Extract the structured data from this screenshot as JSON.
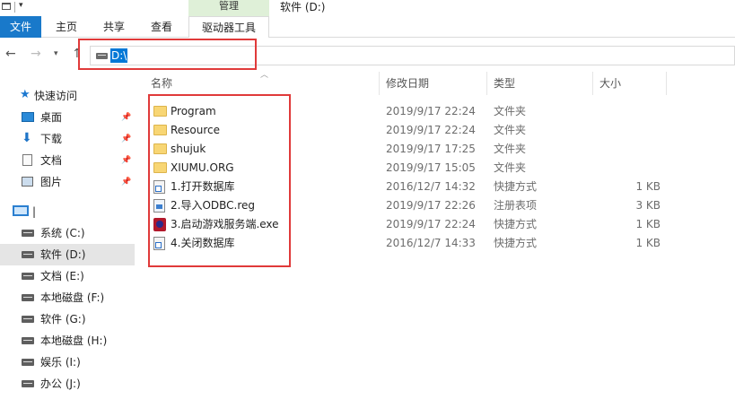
{
  "window": {
    "context_tab_header": "管理",
    "title": "软件 (D:)"
  },
  "ribbon": {
    "tabs": [
      "文件",
      "主页",
      "共享",
      "查看",
      "驱动器工具"
    ]
  },
  "address_bar": {
    "path": "D:\\"
  },
  "nav_pane": {
    "quick_access": "快速访问",
    "pinned": [
      "桌面",
      "下载",
      "文档",
      "图片"
    ],
    "this_pc": "|",
    "drives": [
      "系统 (C:)",
      "软件 (D:)",
      "文档 (E:)",
      "本地磁盘 (F:)",
      "软件 (G:)",
      "本地磁盘 (H:)",
      "娱乐 (I:)",
      "办公 (J:)"
    ]
  },
  "file_list": {
    "columns": [
      "名称",
      "修改日期",
      "类型",
      "大小"
    ],
    "rows": [
      {
        "name": "Program",
        "date": "2019/9/17 22:24",
        "type": "文件夹",
        "size": "",
        "icon": "folder-icon"
      },
      {
        "name": "Resource",
        "date": "2019/9/17 22:24",
        "type": "文件夹",
        "size": "",
        "icon": "folder-icon"
      },
      {
        "name": "shujuk",
        "date": "2019/9/17 17:25",
        "type": "文件夹",
        "size": "",
        "icon": "folder-icon"
      },
      {
        "name": "XIUMU.ORG",
        "date": "2019/9/17 15:05",
        "type": "文件夹",
        "size": "",
        "icon": "folder-icon"
      },
      {
        "name": "1.打开数据库",
        "date": "2016/12/7 14:32",
        "type": "快捷方式",
        "size": "1 KB",
        "icon": "shortcut-icon"
      },
      {
        "name": "2.导入ODBC.reg",
        "date": "2019/9/17 22:26",
        "type": "注册表项",
        "size": "3 KB",
        "icon": "registry-file-icon"
      },
      {
        "name": "3.启动游戏服务端.exe",
        "date": "2019/9/17 22:24",
        "type": "快捷方式",
        "size": "1 KB",
        "icon": "game-exe-icon"
      },
      {
        "name": "4.关闭数据库",
        "date": "2016/12/7 14:33",
        "type": "快捷方式",
        "size": "1 KB",
        "icon": "shortcut-icon"
      }
    ]
  },
  "colors": {
    "accent": "#1979ca",
    "selection": "#0078d7",
    "highlight_box": "#e03a3a",
    "context_tab": "#dff0d8"
  }
}
